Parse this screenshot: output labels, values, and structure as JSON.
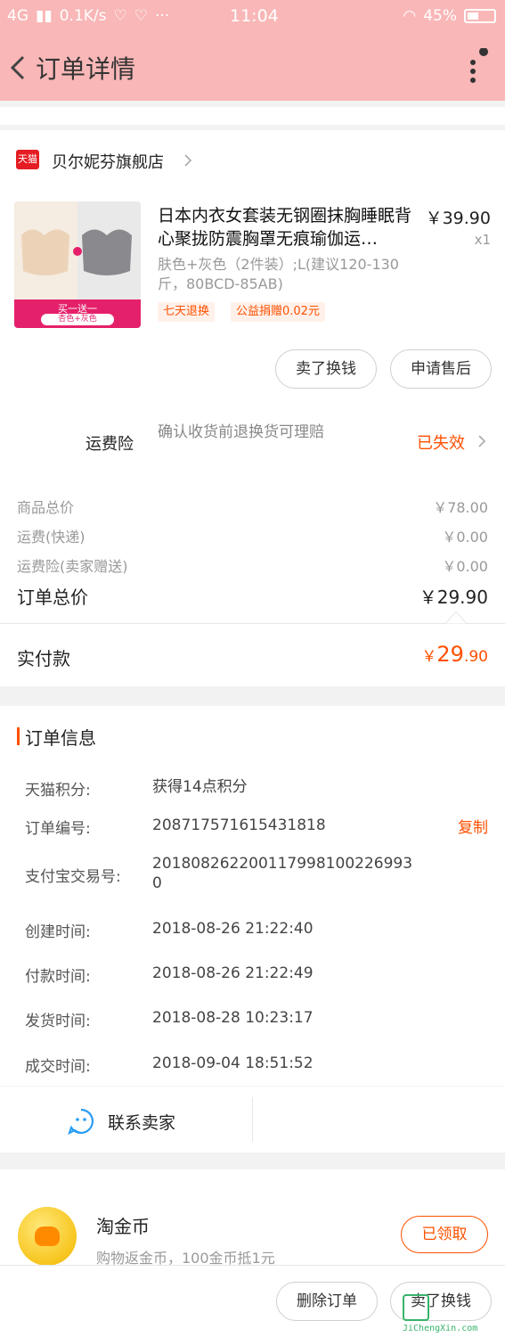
{
  "status_bar": {
    "network": "4G",
    "speed": "0.1K/s",
    "time": "11:04",
    "battery": "45%"
  },
  "header": {
    "title": "订单详情"
  },
  "store": {
    "badge": "天猫",
    "name": "贝尔妮芬旗舰店"
  },
  "product": {
    "title": "日本内衣女套装无钢圈抹胸睡眠背心聚拢防震胸罩无痕瑜伽运…",
    "price": "￥39.90",
    "quantity": "x1",
    "spec": "肤色+灰色（2件装）;L(建议120-130斤，80BCD-85AB)",
    "thumb_banner": "买一送一",
    "thumb_sub": "杏色+灰色",
    "tags": [
      "七天退换",
      "公益捐赠0.02元"
    ],
    "buttons": [
      "卖了换钱",
      "申请售后"
    ]
  },
  "insurance": {
    "label": "运费险",
    "desc": "确认收货前退换货可理赔",
    "status": "已失效"
  },
  "price_rows": [
    {
      "label": "商品总价",
      "value": "￥78.00"
    },
    {
      "label": "运费(快递)",
      "value": "￥0.00"
    },
    {
      "label": "运费险(卖家赠送)",
      "value": "￥0.00"
    }
  ],
  "order_total": {
    "label": "订单总价",
    "value": "￥29.90"
  },
  "paid": {
    "label": "实付款",
    "currency": "￥",
    "integer": "29",
    "decimal": ".90"
  },
  "order_info": {
    "title": "订单信息",
    "copy_label": "复制",
    "rows": [
      {
        "label": "天猫积分:",
        "value": "获得14点积分"
      },
      {
        "label": "订单编号:",
        "value": "208717571615431818"
      },
      {
        "label": "支付宝交易号:",
        "value": "2018082622001179981002269930"
      },
      {
        "label": "创建时间:",
        "value": "2018-08-26 21:22:40"
      },
      {
        "label": "付款时间:",
        "value": "2018-08-26 21:22:49"
      },
      {
        "label": "发货时间:",
        "value": "2018-08-28 10:23:17"
      },
      {
        "label": "成交时间:",
        "value": "2018-09-04 18:51:52"
      }
    ]
  },
  "contact": {
    "label": "联系卖家"
  },
  "coin": {
    "title": "淘金币",
    "desc": "购物返金币，100金币抵1元",
    "button": "已领取"
  },
  "bottom_buttons": [
    "删除订单",
    "卖了换钱"
  ],
  "watermark": {
    "text": "JiChengXin.com"
  },
  "colors": {
    "accent": "#ff5000",
    "header_bg": "#f9b7b7",
    "tmall_red": "#e51c23"
  }
}
